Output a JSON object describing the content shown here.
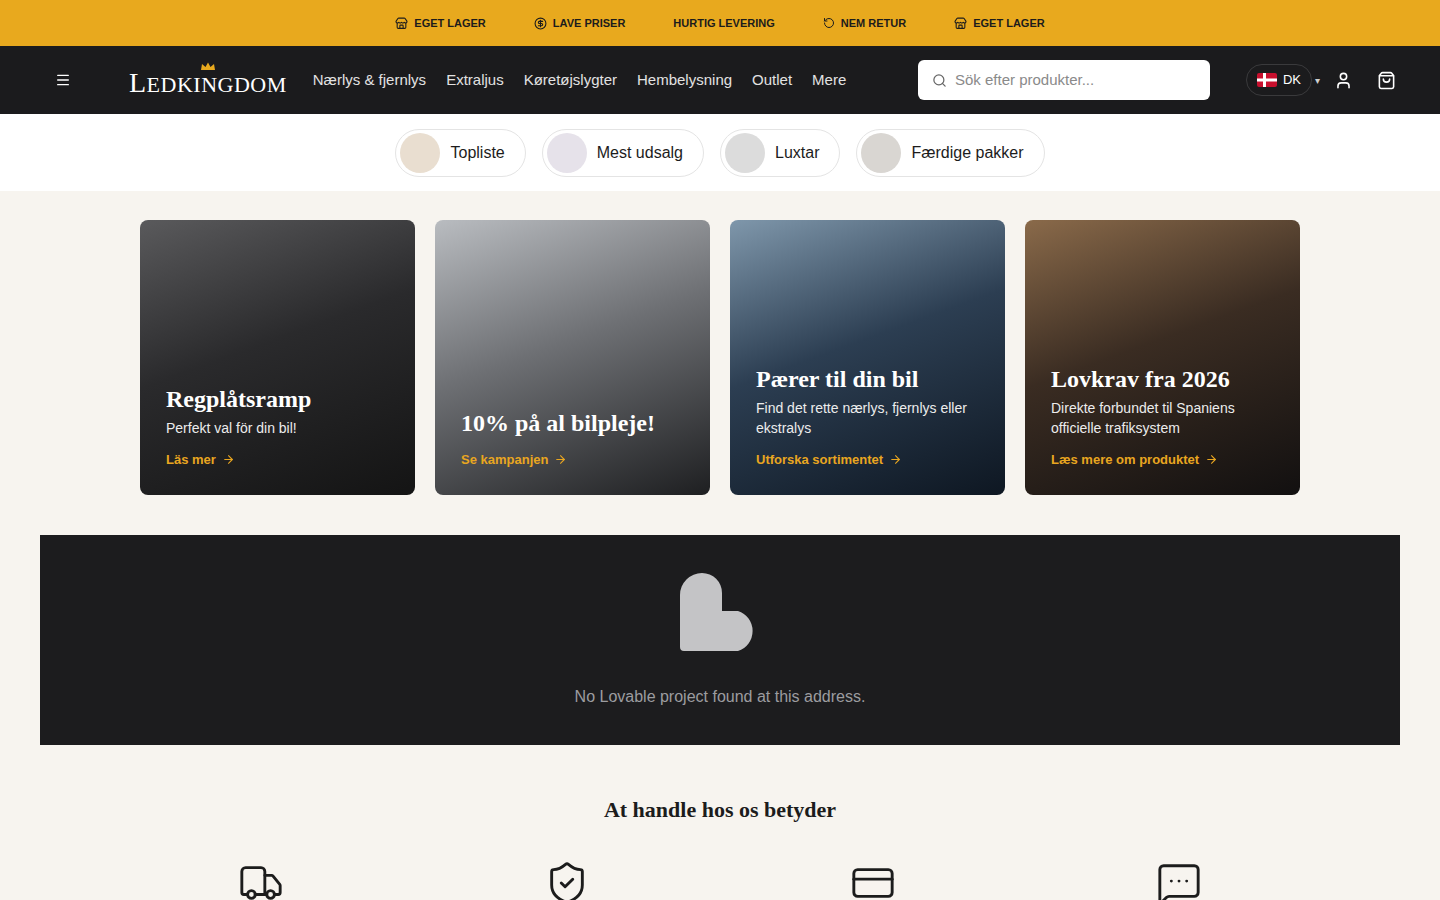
{
  "announcement_bar": [
    {
      "label": "EGET LAGER",
      "kind": "store"
    },
    {
      "label": "LAVE PRISER",
      "kind": "coin"
    },
    {
      "label": "HURTIG LEVERING",
      "kind": "plain"
    },
    {
      "label": "NEM RETUR",
      "kind": "return"
    },
    {
      "label": "EGET LAGER",
      "kind": "store"
    }
  ],
  "logo": {
    "text": "LEDKINGDOM"
  },
  "nav": {
    "links": [
      "Nærlys & fjernlys",
      "Extraljus",
      "Køretøjslygter",
      "Hembelysning",
      "Outlet",
      "Mere"
    ]
  },
  "search": {
    "placeholder": "Sök efter produkter..."
  },
  "country": {
    "code": "DK",
    "caret": "▾"
  },
  "category_pills": [
    "Topliste",
    "Mest udsalg",
    "Luxtar",
    "Færdige pakker"
  ],
  "cards": [
    {
      "title": "Regplåtsramp",
      "subtitle": "Perfekt val för din bil!",
      "link": "Läs mer"
    },
    {
      "title": "10% på al bilpleje!",
      "subtitle": "",
      "link": "Se kampanjen"
    },
    {
      "title": "Pærer til din bil",
      "subtitle": "Find det rette nærlys, fjernlys eller ekstralys",
      "link": "Utforska sortimentet"
    },
    {
      "title": "Lovkrav fra 2026",
      "subtitle": "Direkte forbundet til Spaniens officielle trafiksystem",
      "link": "Læs mere om produktet"
    }
  ],
  "notice": {
    "text": "No Lovable project found at this address."
  },
  "benefits": {
    "heading": "At handle hos os betyder"
  }
}
